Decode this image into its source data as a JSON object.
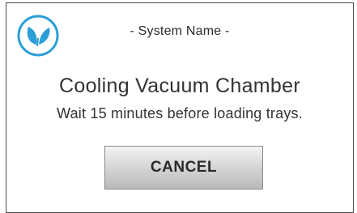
{
  "dialog": {
    "system_name": "- System Name -",
    "title": "Cooling Vacuum Chamber",
    "message": "Wait 15 minutes before loading trays.",
    "cancel_label": "CANCEL",
    "logo_icon": "leaf-sprout-icon",
    "accent_color": "#2a9fd6"
  }
}
